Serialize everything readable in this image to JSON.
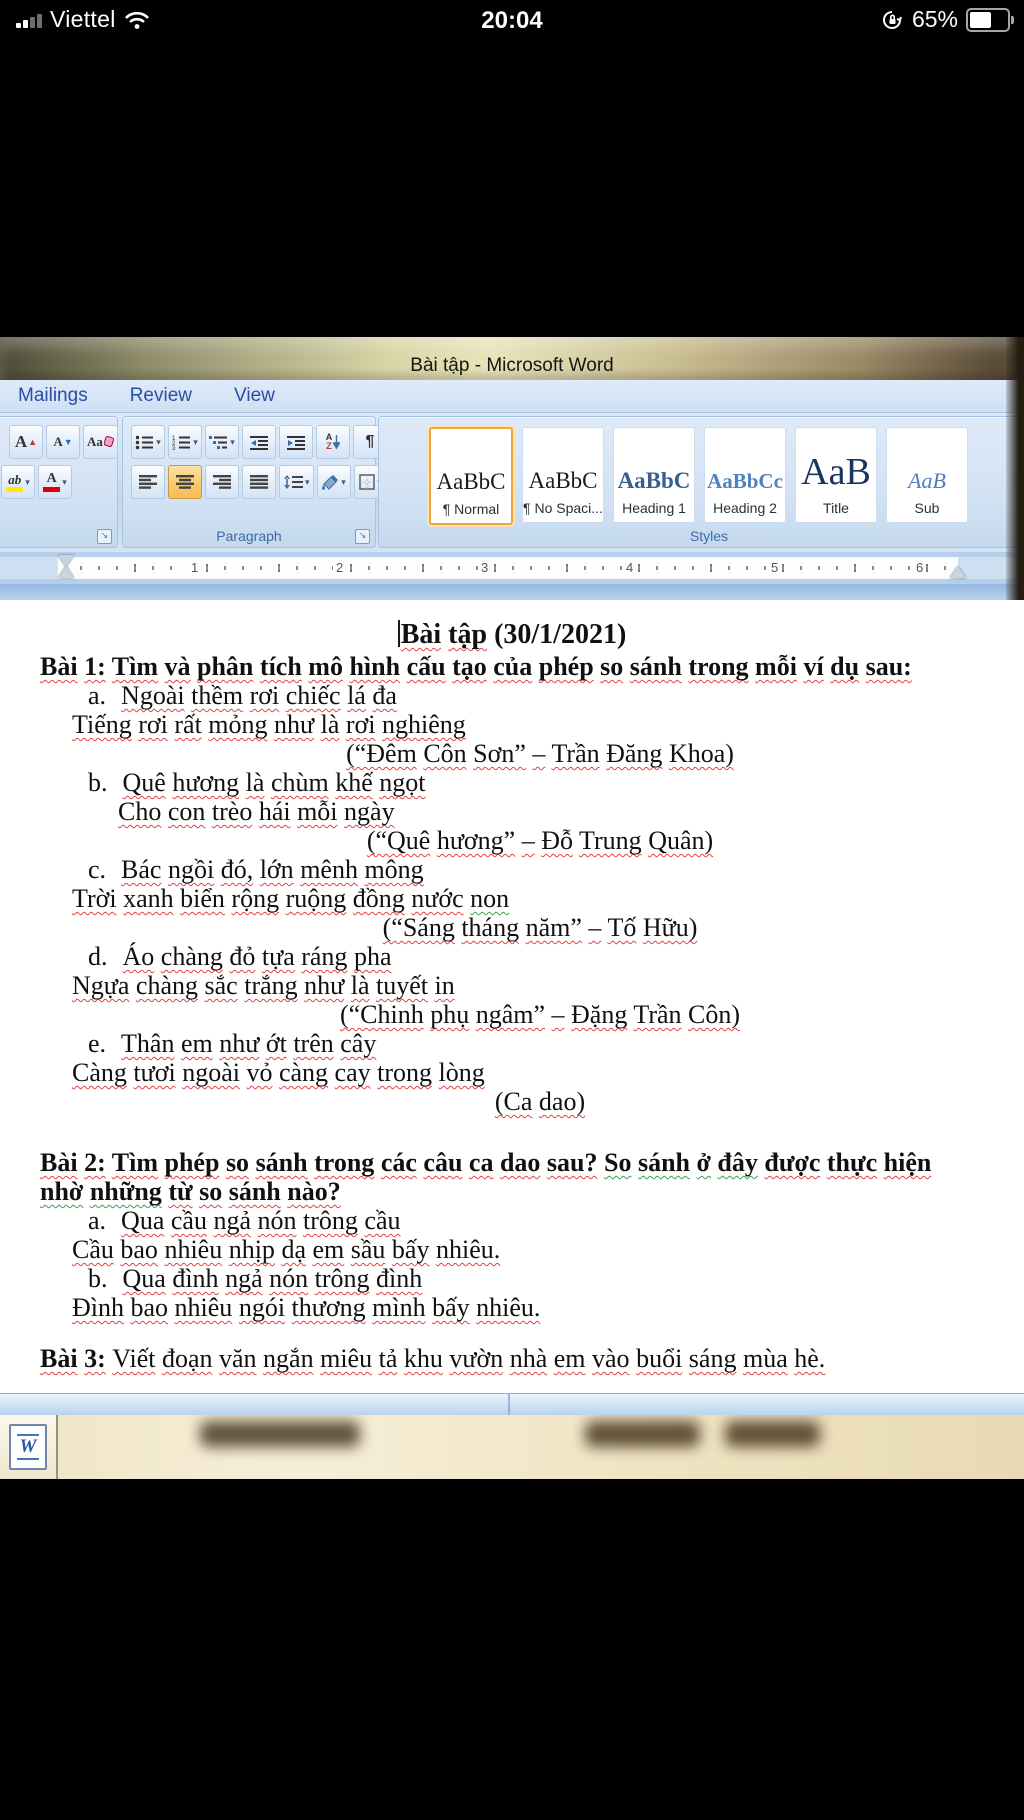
{
  "status_bar": {
    "carrier": "Viettel",
    "time": "20:04",
    "battery_percent": "65%",
    "battery_level": 0.65
  },
  "window": {
    "title": "Bài tập  -  Microsoft Word"
  },
  "ribbon": {
    "tabs": [
      {
        "label": "Mailings"
      },
      {
        "label": "Review"
      },
      {
        "label": "View"
      }
    ],
    "paragraph_label": "Paragraph",
    "styles_label": "Styles",
    "styles": [
      {
        "preview": "AaBbC",
        "label": "¶ Normal",
        "cls": "norm",
        "selected": true
      },
      {
        "preview": "AaBbC",
        "label": "¶ No Spaci...",
        "cls": "norm",
        "selected": false
      },
      {
        "preview": "AaBbC",
        "label": "Heading 1",
        "cls": "h1",
        "selected": false
      },
      {
        "preview": "AaBbCc",
        "label": "Heading 2",
        "cls": "h2",
        "selected": false
      },
      {
        "preview": "AaB",
        "label": "Title",
        "cls": "ttl",
        "selected": false
      },
      {
        "preview": "AaB",
        "label": "Sub",
        "cls": "sub",
        "selected": false
      }
    ]
  },
  "glyphs": {
    "caret": "▾",
    "pilcrow": "¶",
    "growA": "A",
    "shrinkA": "A",
    "up": "▲",
    "down": "▼",
    "case": "Aa",
    "highlight": "ab",
    "fontcolor": "A",
    "sortA": "A",
    "sortZ": "Z",
    "launcher": "↘",
    "wdoc": "W"
  },
  "ruler": {
    "numbers": [
      "1",
      "2",
      "3",
      "4",
      "5",
      "6"
    ]
  },
  "document": {
    "lines": [
      {
        "type": "title",
        "cursor": true,
        "segs": [
          {
            "t": "Bài tập",
            "b": 1,
            "w": "r"
          },
          {
            "t": " (30/1/2021)",
            "b": 1
          }
        ]
      },
      {
        "indent": 40,
        "segs": [
          {
            "t": "Bài 1: ",
            "b": 1,
            "w": "r"
          },
          {
            "t": "Tìm và phân tích mô hình cấu tạo của phép so sánh trong mỗi ví dụ sau:",
            "b": 1,
            "w": "r"
          }
        ]
      },
      {
        "indent": 88,
        "segs": [
          {
            "t": "a.",
            "m": 1
          },
          {
            "t": "Ngoài thềm rơi chiếc lá đa",
            "w": "r"
          }
        ]
      },
      {
        "indent": 72,
        "segs": [
          {
            "t": "Tiếng rơi rất mỏng như là rơi nghiêng",
            "w": "r"
          }
        ]
      },
      {
        "type": "attr",
        "segs": [
          {
            "t": "(“Đêm Côn Sơn” – Trần Đăng Khoa)",
            "w": "r"
          }
        ]
      },
      {
        "indent": 88,
        "segs": [
          {
            "t": "b.",
            "m": 1
          },
          {
            "t": "Quê hương là chùm khế ngọt",
            "w": "r"
          }
        ]
      },
      {
        "indent": 118,
        "segs": [
          {
            "t": "Cho con trèo hái mỗi ngày",
            "w": "r"
          }
        ]
      },
      {
        "type": "attr",
        "segs": [
          {
            "t": "(“Quê hương” – Đỗ Trung Quân)",
            "w": "r"
          }
        ]
      },
      {
        "indent": 88,
        "segs": [
          {
            "t": "c.",
            "m": 1
          },
          {
            "t": "Bác ngồi đó, lớn mênh mông",
            "w": "r"
          }
        ]
      },
      {
        "indent": 72,
        "segs": [
          {
            "t": "Trời xanh biển rộng ruộng đồng nước",
            "w": "r"
          },
          {
            "t": " non",
            "w": "g"
          }
        ]
      },
      {
        "type": "attr",
        "segs": [
          {
            "t": "(“Sáng tháng năm” – Tố Hữu)",
            "w": "r"
          }
        ]
      },
      {
        "indent": 88,
        "segs": [
          {
            "t": "d.",
            "m": 1
          },
          {
            "t": "Áo chàng đỏ tựa ráng pha",
            "w": "r"
          }
        ]
      },
      {
        "indent": 72,
        "segs": [
          {
            "t": "Ngựa chàng sắc trắng như là tuyết in",
            "w": "r"
          }
        ]
      },
      {
        "type": "attr",
        "segs": [
          {
            "t": "(“Chinh phụ ngâm” – Đặng Trần Côn)",
            "w": "r"
          }
        ]
      },
      {
        "indent": 88,
        "segs": [
          {
            "t": "e.",
            "m": 1
          },
          {
            "t": "Thân em như ớt trên cây",
            "w": "r"
          }
        ]
      },
      {
        "indent": 72,
        "segs": [
          {
            "t": "Càng tươi ngoài vỏ càng cay trong lòng",
            "w": "r"
          }
        ]
      },
      {
        "type": "attr",
        "segs": [
          {
            "t": "(Ca dao)",
            "w": "r"
          }
        ]
      },
      {
        "spacer": 32
      },
      {
        "indent": 40,
        "segs": [
          {
            "t": "Bài 2: ",
            "b": 1,
            "w": "r"
          },
          {
            "t": "Tìm phép so sánh trong các câu ca dao sau? ",
            "b": 1,
            "w": "r"
          },
          {
            "t": "So sánh ở đây",
            "b": 1,
            "w": "g"
          },
          {
            "t": " được thực hiện",
            "b": 1,
            "w": "r"
          }
        ]
      },
      {
        "indent": 40,
        "segs": [
          {
            "t": "nhờ những",
            "b": 1,
            "w": "g"
          },
          {
            "t": "  từ so sánh nào?",
            "b": 1,
            "w": "r"
          }
        ]
      },
      {
        "indent": 88,
        "segs": [
          {
            "t": "a.",
            "m": 1
          },
          {
            "t": "Qua cầu ngả nón trông cầu",
            "w": "r"
          }
        ]
      },
      {
        "indent": 72,
        "segs": [
          {
            "t": "Cầu bao nhiêu nhịp dạ em sầu bấy nhiêu.",
            "w": "r"
          }
        ]
      },
      {
        "indent": 88,
        "segs": [
          {
            "t": "b.",
            "m": 1
          },
          {
            "t": "Qua đình ngả nón trông đình",
            "w": "r"
          }
        ]
      },
      {
        "indent": 72,
        "segs": [
          {
            "t": "Đình bao nhiêu ngói thương mình bấy nhiêu.",
            "w": "r"
          }
        ]
      },
      {
        "spacer": 22
      },
      {
        "indent": 40,
        "segs": [
          {
            "t": "Bài 3: ",
            "b": 1,
            "w": "r"
          },
          {
            "t": "Viết đoạn văn ngắn miêu tả khu vườn nhà em vào buổi sáng mùa hè.",
            "w": "r"
          }
        ]
      }
    ]
  }
}
